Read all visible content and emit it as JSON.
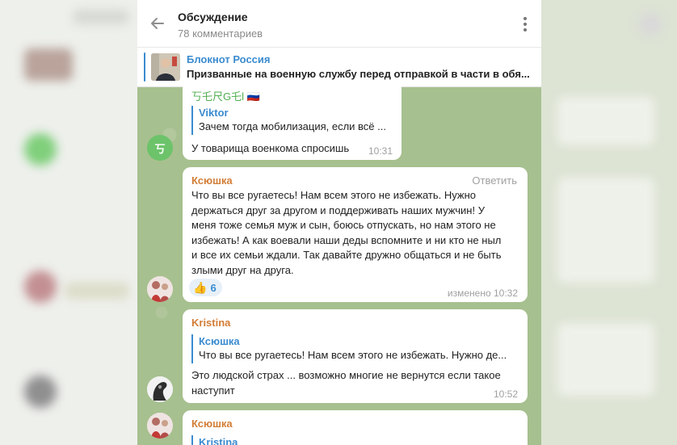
{
  "header": {
    "title": "Обсуждение",
    "subtitle": "78 комментариев"
  },
  "pinned": {
    "channel": "Блокнот Россия",
    "text": "Призванные на военную службу перед отправкой в части в обя..."
  },
  "messages": [
    {
      "sender": "丂乇尺G乇l",
      "sender_flag": "🇷🇺",
      "reply_name": "Viktor",
      "reply_text": "Зачем тогда мобилизация, если всё ...",
      "text": "У товарища военкома спросишь",
      "time": "10:31",
      "avatar_letter": "丂"
    },
    {
      "sender": "Ксюшка",
      "action": "Ответить",
      "text_lines": [
        "Что вы все ругаетесь! Нам всем этого не избежать. Нужно",
        "держаться друг за другом и поддерживать наших мужчин! У",
        "меня тоже семья муж и сын, боюсь отпускать, но нам этого не",
        "избежать! А как воевали наши деды вспомните и ни кто не ныл",
        "и все их семьи ждали. Так давайте дружно общаться и не быть",
        "злыми друг на друга."
      ],
      "reaction_emoji": "👍",
      "reaction_count": "6",
      "time": "изменено 10:32"
    },
    {
      "sender": "Kristina",
      "reply_name": "Ксюшка",
      "reply_text": "Что вы все ругаетесь! Нам всем этого не избежать. Нужно де...",
      "text_lines": [
        "Это людской  страх  ... возможно многие не вернутся если такое",
        "наступит"
      ],
      "time": "10:52"
    },
    {
      "sender": "Ксюшка",
      "reply_name": "Kristina"
    }
  ],
  "colors": {
    "accent": "#3a8bd0",
    "sender_orange": "#d27d36",
    "chat_bg": "#a7c08f"
  }
}
